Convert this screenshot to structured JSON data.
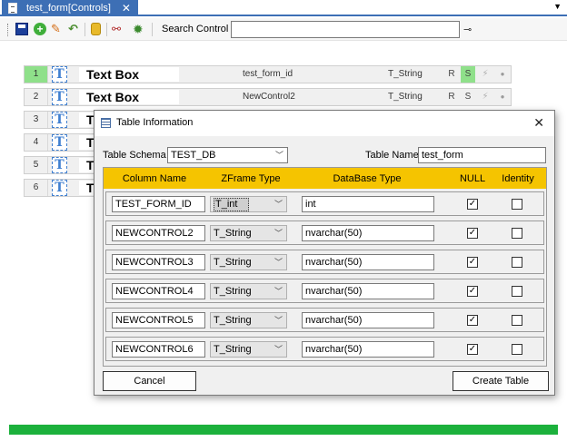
{
  "tab": {
    "title": "test_form[Controls]",
    "close": "✕"
  },
  "toolbar": {
    "search_label": "Search Control",
    "search_value": ""
  },
  "controls": [
    {
      "index": "1",
      "label": "Text Box",
      "id": "test_form_id",
      "type": "T_String",
      "r": "R",
      "s": "S",
      "selected": true
    },
    {
      "index": "2",
      "label": "Text Box",
      "id": "NewControl2",
      "type": "T_String",
      "r": "R",
      "s": "S"
    },
    {
      "index": "3",
      "label": "T"
    },
    {
      "index": "4",
      "label": "T"
    },
    {
      "index": "5",
      "label": "T"
    },
    {
      "index": "6",
      "label": "T"
    }
  ],
  "dialog": {
    "title": "Table Information",
    "close": "✕",
    "schema_label": "Table Schema :",
    "schema_value": "TEST_DB",
    "table_name_label": "Table Name :",
    "table_name_value": "test_form",
    "headers": {
      "column_name": "Column Name",
      "zframe_type": "ZFrame Type",
      "database_type": "DataBase Type",
      "null": "NULL",
      "identity": "Identity"
    },
    "rows": [
      {
        "column": "TEST_FORM_ID",
        "zframe": "T_int",
        "dbtype": "int",
        "null": true,
        "identity": false
      },
      {
        "column": "NEWCONTROL2",
        "zframe": "T_String",
        "dbtype": "nvarchar(50)",
        "null": true,
        "identity": false
      },
      {
        "column": "NEWCONTROL3",
        "zframe": "T_String",
        "dbtype": "nvarchar(50)",
        "null": true,
        "identity": false
      },
      {
        "column": "NEWCONTROL4",
        "zframe": "T_String",
        "dbtype": "nvarchar(50)",
        "null": true,
        "identity": false
      },
      {
        "column": "NEWCONTROL5",
        "zframe": "T_String",
        "dbtype": "nvarchar(50)",
        "null": true,
        "identity": false
      },
      {
        "column": "NEWCONTROL6",
        "zframe": "T_String",
        "dbtype": "nvarchar(50)",
        "null": true,
        "identity": false
      }
    ],
    "cancel_label": "Cancel",
    "create_label": "Create Table"
  },
  "progress": {
    "fraction": 1.0,
    "color": "#1cb13c"
  },
  "colors": {
    "tab": "#3d6fb5",
    "grid_header": "#f5c400",
    "selected_row": "#8fe08a"
  }
}
